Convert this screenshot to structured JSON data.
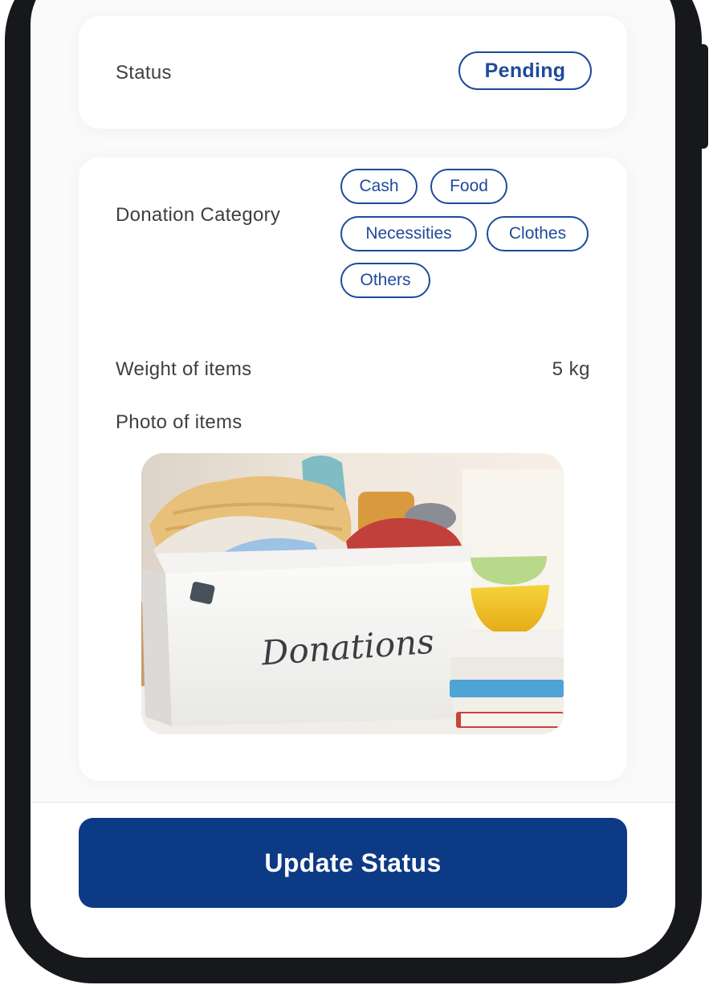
{
  "status": {
    "label": "Status",
    "value": "Pending"
  },
  "details": {
    "category_label": "Donation Category",
    "categories": [
      "Cash",
      "Food",
      "Necessities",
      "Clothes",
      "Others"
    ],
    "weight_label": "Weight of items",
    "weight_value": "5 kg",
    "photo_label": "Photo of items",
    "photo_box_text": "Donations"
  },
  "actions": {
    "update_status": "Update Status"
  },
  "colors": {
    "accent": "#1f4a9a",
    "button": "#0d3a85"
  }
}
